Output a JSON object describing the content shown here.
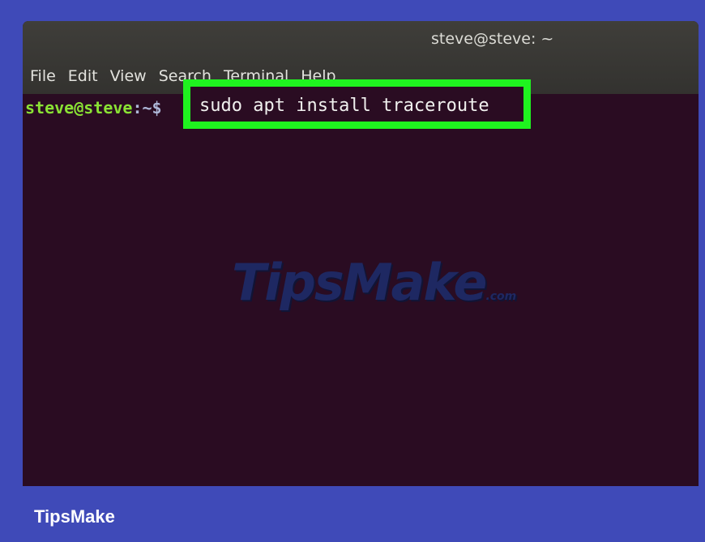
{
  "window": {
    "title": "steve@steve: ~"
  },
  "menu": {
    "items": [
      "File",
      "Edit",
      "View",
      "Search",
      "Terminal",
      "Help"
    ]
  },
  "terminal": {
    "prompt_user": "steve@steve",
    "prompt_path": ":~$",
    "command": "sudo apt install traceroute"
  },
  "watermark": {
    "text": "TipsMake",
    "suffix": ".com"
  },
  "footer": {
    "brand": "TipsMake"
  },
  "colors": {
    "background": "#3f4ab8",
    "terminal_bg": "#2a0c22",
    "highlight": "#1ff31f",
    "prompt_user": "#8ae234"
  }
}
